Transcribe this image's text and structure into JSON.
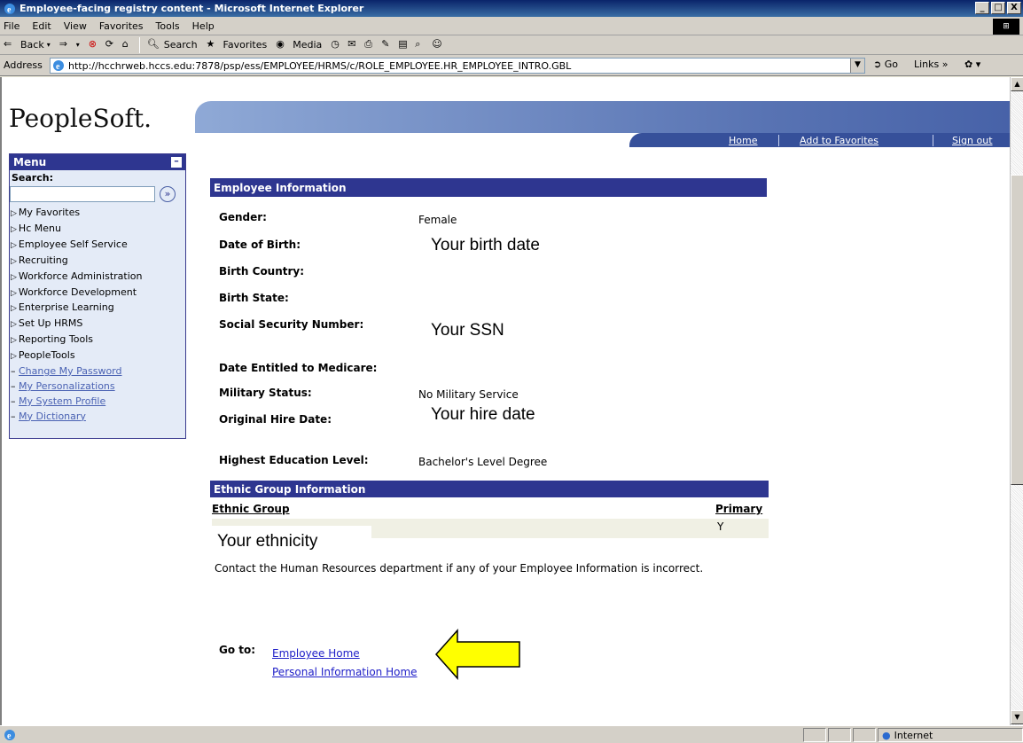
{
  "window": {
    "title": "Employee-facing registry content - Microsoft Internet Explorer",
    "controls": [
      "_",
      "□",
      "X"
    ]
  },
  "menubar": [
    "File",
    "Edit",
    "View",
    "Favorites",
    "Tools",
    "Help"
  ],
  "toolbar": {
    "back": "Back",
    "search": "Search",
    "favorites": "Favorites",
    "media": "Media"
  },
  "address": {
    "label": "Address",
    "url": "http://hcchrweb.hccs.edu:7878/psp/ess/EMPLOYEE/HRMS/c/ROLE_EMPLOYEE.HR_EMPLOYEE_INTRO.GBL",
    "go": "Go",
    "links": "Links"
  },
  "peoplesoft": {
    "logo": "PeopleSoft.",
    "nav": [
      "Home",
      "Add to Favorites",
      "Sign out"
    ]
  },
  "menu": {
    "title": "Menu",
    "search_label": "Search:",
    "folders": [
      "My Favorites",
      "Hc Menu",
      "Employee Self Service",
      "Recruiting",
      "Workforce Administration",
      "Workforce Development",
      "Enterprise Learning",
      "Set Up HRMS",
      "Reporting Tools",
      "PeopleTools"
    ],
    "links": [
      "Change My Password",
      "My Personalizations",
      "My System Profile",
      "My Dictionary"
    ]
  },
  "employee_info": {
    "header": "Employee Information",
    "fields": [
      {
        "label": "Gender:",
        "value": "Female"
      },
      {
        "label": "Date of Birth:",
        "value": ""
      },
      {
        "label": "Birth Country:",
        "value": ""
      },
      {
        "label": "Birth State:",
        "value": ""
      },
      {
        "label": "Social Security Number:",
        "value": ""
      },
      {
        "label": "Date Entitled to Medicare:",
        "value": ""
      },
      {
        "label": "Military Status:",
        "value": "No Military Service"
      },
      {
        "label": "Original Hire Date:",
        "value": ""
      },
      {
        "label": "Highest Education Level:",
        "value": "Bachelor's Level Degree"
      }
    ],
    "overlays": {
      "birth_date": "Your birth date",
      "ssn": "Your SSN",
      "hire_date": "Your hire date"
    }
  },
  "ethnic_group": {
    "header": "Ethnic Group Information",
    "col_group": "Ethnic Group",
    "col_primary": "Primary",
    "primary_value": "Y",
    "overlay": "Your ethnicity"
  },
  "notice": "Contact the Human Resources department if any of your Employee Information is incorrect.",
  "goto": {
    "label": "Go to:",
    "links": [
      "Employee Home",
      "Personal Information Home"
    ]
  },
  "statusbar": {
    "zone": "Internet"
  },
  "colors": {
    "header_blue": "#2e3690",
    "arrow_yellow": "#ffff00"
  }
}
